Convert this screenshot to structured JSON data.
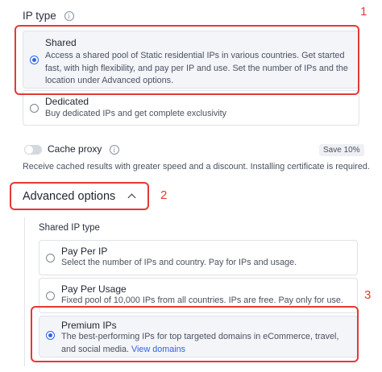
{
  "ip_type": {
    "title": "IP type",
    "info_glyph": "i",
    "options": [
      {
        "title": "Shared",
        "description": "Access a shared pool of Static residential IPs in various countries. Get started fast, with high flexibility, and pay per IP and use. Set the number of IPs and the location under Advanced options.",
        "selected": true
      },
      {
        "title": "Dedicated",
        "description": "Buy dedicated IPs and get complete exclusivity",
        "selected": false
      }
    ]
  },
  "cache_proxy": {
    "label": "Cache proxy",
    "info_glyph": "i",
    "enabled": false,
    "badge": "Save 10%",
    "description": "Receive cached results with greater speed and a discount. Installing certificate is required."
  },
  "advanced": {
    "title": "Advanced options",
    "expanded": true
  },
  "shared_ip_type": {
    "title": "Shared IP type",
    "options": [
      {
        "title": "Pay Per IP",
        "description": "Select the number of IPs and country. Pay for IPs and usage.",
        "selected": false
      },
      {
        "title": "Pay Per Usage",
        "description": "Fixed pool of 10,000 IPs from all countries. IPs are free. Pay only for use.",
        "selected": false
      },
      {
        "title": "Premium IPs",
        "description": "The best-performing IPs for top targeted domains in eCommerce, travel, and social media.",
        "link": "View domains",
        "selected": true
      }
    ]
  },
  "annotations": [
    "1",
    "2",
    "3"
  ],
  "colors": {
    "accent": "#2f64e6",
    "annotation": "#e53935"
  }
}
